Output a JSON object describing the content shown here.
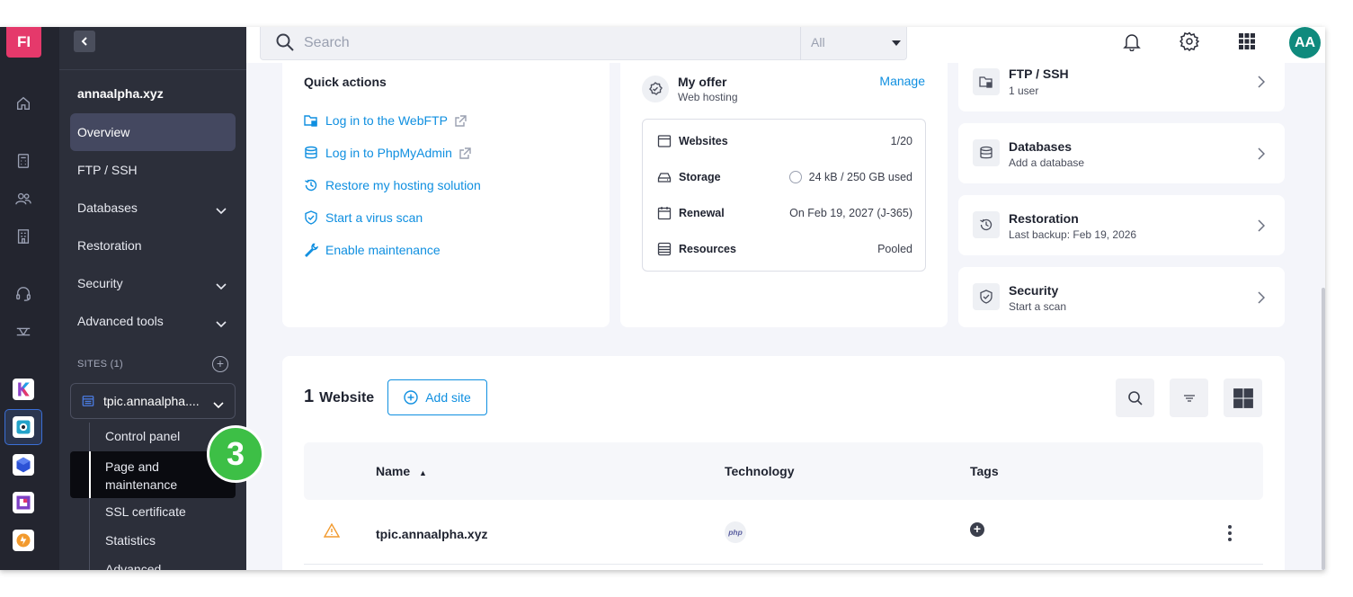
{
  "rail": {
    "logo": "FI",
    "icons": [
      "home-icon",
      "calculator-icon",
      "users-icon",
      "building-icon",
      "headset-icon",
      "network-icon"
    ],
    "apps": [
      "kchat-app",
      "hosting-app",
      "cube-app",
      "kdrive-app",
      "swiss-backup-app"
    ]
  },
  "sidebar": {
    "domain": "annaalpha.xyz",
    "items": [
      {
        "label": "Overview",
        "active": true
      },
      {
        "label": "FTP / SSH"
      },
      {
        "label": "Databases",
        "expandable": true
      },
      {
        "label": "Restoration"
      },
      {
        "label": "Security",
        "expandable": true
      },
      {
        "label": "Advanced tools",
        "expandable": true
      }
    ],
    "sites_label": "SITES (1)",
    "site_name": "tpic.annaalpha....",
    "sub_items": [
      "Control panel",
      "Page and maintenance",
      "SSL certificate",
      "Statistics",
      "Advanced"
    ]
  },
  "badge": "3",
  "header": {
    "search_placeholder": "Search",
    "filter_value": "All",
    "avatar_initials": "AA",
    "icons": [
      "bell-icon",
      "gear-icon",
      "apps-grid-icon"
    ]
  },
  "quick_actions": {
    "title": "Quick actions",
    "items": [
      {
        "label": "Log in to the WebFTP",
        "external": true
      },
      {
        "label": "Log in to PhpMyAdmin",
        "external": true
      },
      {
        "label": "Restore my hosting solution"
      },
      {
        "label": "Start a virus scan"
      },
      {
        "label": "Enable maintenance"
      }
    ]
  },
  "offer": {
    "title": "My offer",
    "subtitle": "Web hosting",
    "manage_label": "Manage",
    "rows": [
      {
        "label": "Websites",
        "value": "1/20"
      },
      {
        "label": "Storage",
        "value": "24 kB / 250 GB used"
      },
      {
        "label": "Renewal",
        "value": "On Feb 19, 2027 (J-365)"
      },
      {
        "label": "Resources",
        "value": "Pooled"
      }
    ]
  },
  "side_cards": [
    {
      "title": "FTP / SSH",
      "subtitle": "1 user"
    },
    {
      "title": "Databases",
      "subtitle": "Add a database"
    },
    {
      "title": "Restoration",
      "subtitle": "Last backup: Feb 19, 2026"
    },
    {
      "title": "Security",
      "subtitle": "Start a scan"
    }
  ],
  "websites": {
    "count": "1",
    "label": "Website",
    "add_label": "Add site",
    "columns": [
      "Name",
      "Technology",
      "Tags"
    ],
    "rows": [
      {
        "name": "tpic.annaalpha.xyz",
        "technology": "php"
      }
    ]
  },
  "colors": {
    "accent": "#0f8fe0",
    "sidebar_bg": "#2c2f3a",
    "rail_bg": "#23252f",
    "badge": "#3dbf46",
    "avatar": "#0f8a7d",
    "brand": "#e5396b",
    "warning": "#f29a2e"
  }
}
